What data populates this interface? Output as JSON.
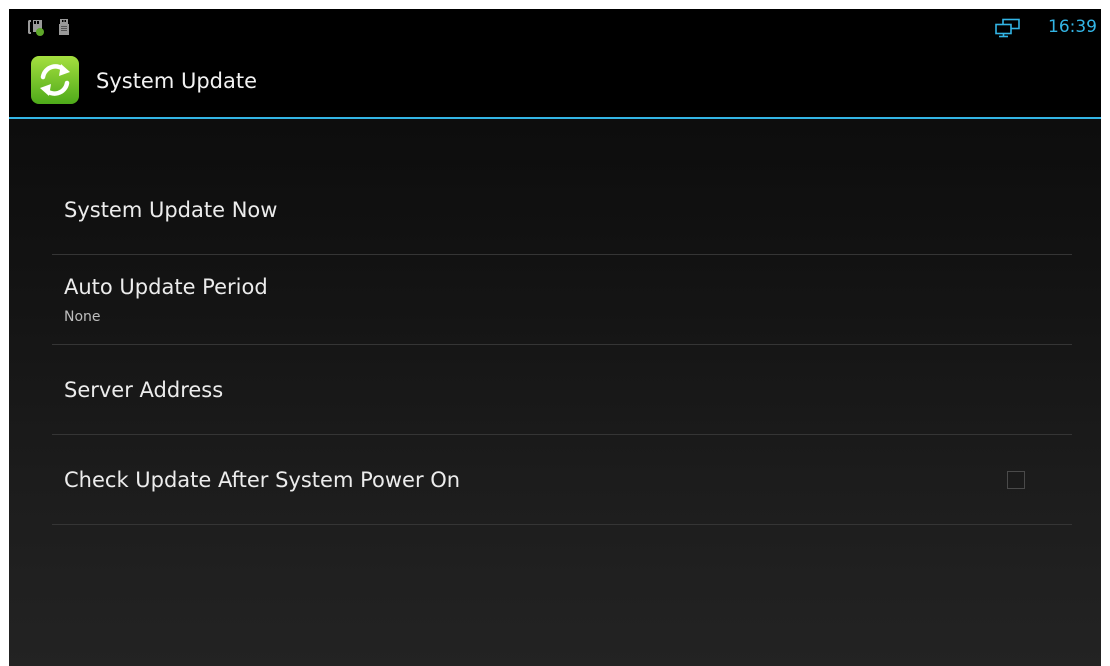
{
  "status_bar": {
    "time": "16:39",
    "icons": [
      "sd-card-icon",
      "usb-icon",
      "network-monitor-icon"
    ],
    "accent": "#33b5e5"
  },
  "action_bar": {
    "title": "System Update",
    "icon": "refresh-icon",
    "divider_color": "#33b5e5"
  },
  "preferences": [
    {
      "title": "System Update Now",
      "summary": ""
    },
    {
      "title": "Auto Update Period",
      "summary": "None"
    },
    {
      "title": "Server Address",
      "summary": ""
    },
    {
      "title": "Check Update After System Power On",
      "summary": "",
      "checkbox": {
        "checked": false
      }
    }
  ]
}
